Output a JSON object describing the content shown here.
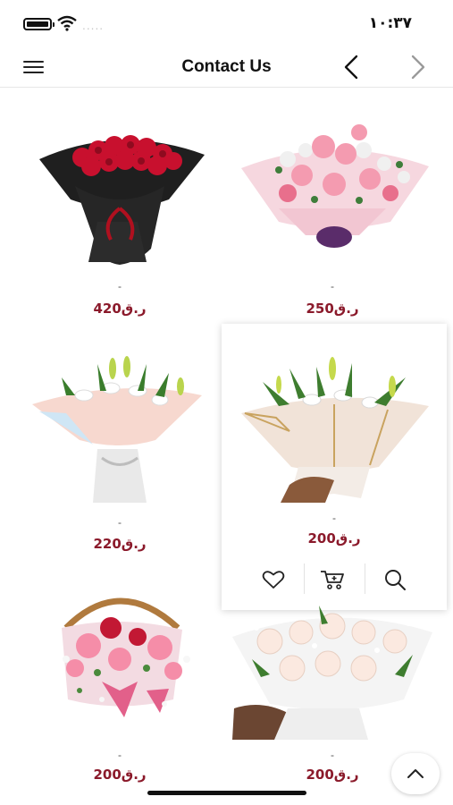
{
  "status_bar": {
    "time": "١٠:٣٧",
    "signal": "....."
  },
  "header": {
    "title": "Contact Us"
  },
  "products": [
    {
      "dash": "-",
      "price": "ر.ق420"
    },
    {
      "dash": "-",
      "price": "ر.ق250"
    },
    {
      "dash": "-",
      "price": "ر.ق220"
    },
    {
      "dash": "-",
      "price": "ر.ق200"
    },
    {
      "dash": "-",
      "price": "ر.ق200"
    },
    {
      "dash": "-",
      "price": "ر.ق200"
    }
  ],
  "colors": {
    "price": "#8b1a2b",
    "rose_red": "#c8102e",
    "wrap_black": "#1f1f1f",
    "pink": "#f4a6b7"
  },
  "icons": [
    "menu-icon",
    "chevron-left-icon",
    "chevron-right-icon",
    "heart-icon",
    "cart-icon",
    "search-icon",
    "chevron-up-icon"
  ]
}
